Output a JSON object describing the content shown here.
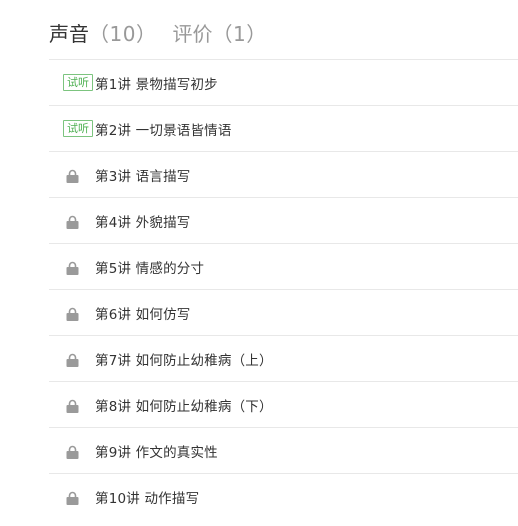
{
  "tabs": {
    "voice": {
      "label": "声音",
      "count": "10"
    },
    "review": {
      "label": "评价",
      "count": "1"
    }
  },
  "colors": {
    "trial_badge": "#4caf50",
    "lock": "#9a9a9a",
    "divider": "#e8e8e8",
    "active_tab": "#333333",
    "inactive_tab": "#999999"
  },
  "lessons": [
    {
      "title": "第1讲 景物描写初步",
      "badge": "试听",
      "locked": false
    },
    {
      "title": "第2讲 一切景语皆情语",
      "badge": "试听",
      "locked": false
    },
    {
      "title": "第3讲 语言描写",
      "icon": "lock-icon",
      "locked": true
    },
    {
      "title": "第4讲 外貌描写",
      "icon": "lock-icon",
      "locked": true
    },
    {
      "title": "第5讲 情感的分寸",
      "icon": "lock-icon",
      "locked": true
    },
    {
      "title": "第6讲 如何仿写",
      "icon": "lock-icon",
      "locked": true
    },
    {
      "title": "第7讲 如何防止幼稚病（上）",
      "icon": "lock-icon",
      "locked": true
    },
    {
      "title": "第8讲 如何防止幼稚病（下）",
      "icon": "lock-icon",
      "locked": true
    },
    {
      "title": "第9讲 作文的真实性",
      "icon": "lock-icon",
      "locked": true
    },
    {
      "title": "第10讲 动作描写",
      "icon": "lock-icon",
      "locked": true
    }
  ]
}
